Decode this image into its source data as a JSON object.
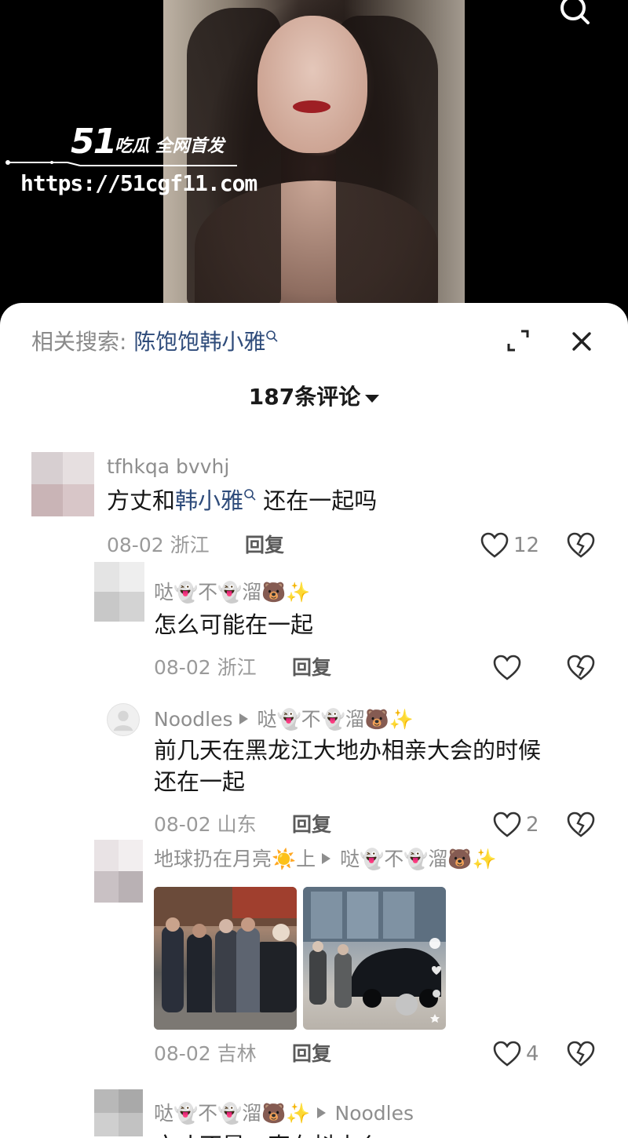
{
  "watermark": {
    "brand": "51",
    "tagline": "吃瓜 全网首发",
    "url": "https://51cgf11.com"
  },
  "sheet": {
    "related_label": "相关搜索:",
    "related_term": "陈饱饱韩小雅",
    "comment_count": "187条评论"
  },
  "comments": [
    {
      "username": "tfhkqa bvvhj",
      "text_before": "方丈和",
      "text_link": "韩小雅",
      "text_after": "还在一起吗",
      "date": "08-02",
      "location": "浙江",
      "reply_label": "回复",
      "likes": "12"
    },
    {
      "username": "哒👻不👻溜🐻✨",
      "text": "怎么可能在一起",
      "date": "08-02",
      "location": "浙江",
      "reply_label": "回复",
      "likes": ""
    },
    {
      "username": "Noodles",
      "reply_to": "哒👻不👻溜🐻✨",
      "text_line1": "前几天在黑龙江大地办相亲大会的时候",
      "text_line2": "还在一起",
      "date": "08-02",
      "location": "山东",
      "reply_label": "回复",
      "likes": "2"
    },
    {
      "username": "地球扔在月亮☀️上",
      "reply_to": "哒👻不👻溜🐻✨",
      "date": "08-02",
      "location": "吉林",
      "reply_label": "回复",
      "likes": "4"
    },
    {
      "username": "哒👻不👻溜🐻✨",
      "reply_to": "Noodles",
      "text": "方丈不是一直在抖山么"
    }
  ],
  "colors": {
    "link": "#2e4b7a",
    "meta": "#9a9a9a",
    "text": "#161616"
  }
}
